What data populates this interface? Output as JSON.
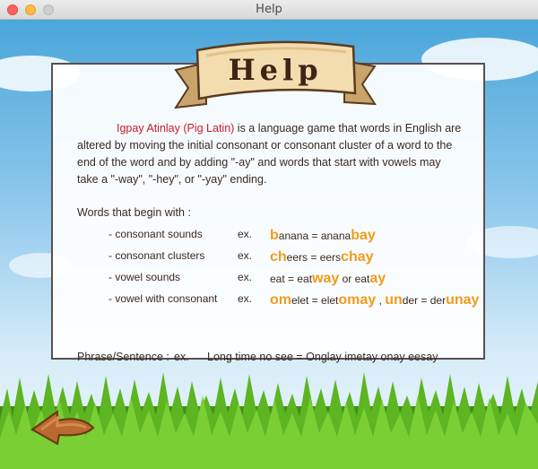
{
  "window": {
    "title": "Help"
  },
  "banner": {
    "title": "Help"
  },
  "intro": {
    "highlight": "Igpay Atinlay (Pig Latin)",
    "text": " is a language game that words in English are altered by moving the initial consonant or consonant cluster of a word to the end of the word and by adding \"-ay\" and words that start with vowels may take a \"-way\", \"-hey\", or \"-yay\" ending."
  },
  "words_heading": "Words that begin with :",
  "examples": [
    {
      "label": "- consonant sounds",
      "ex": "ex.",
      "parts": [
        [
          "b",
          "o"
        ],
        [
          "anana = anana",
          ""
        ],
        [
          "bay",
          "o"
        ]
      ]
    },
    {
      "label": "- consonant clusters",
      "ex": "ex.",
      "parts": [
        [
          "ch",
          "o"
        ],
        [
          "eers = eers",
          ""
        ],
        [
          "chay",
          "o"
        ]
      ]
    },
    {
      "label": "- vowel sounds",
      "ex": "ex.",
      "parts": [
        [
          "eat = eat",
          ""
        ],
        [
          "way",
          "o"
        ],
        [
          " or eat",
          ""
        ],
        [
          "ay",
          "o"
        ]
      ]
    },
    {
      "label": "- vowel with consonant",
      "ex": "ex.",
      "parts": [
        [
          "om",
          "o"
        ],
        [
          "elet = elet",
          ""
        ],
        [
          "omay",
          "o"
        ],
        [
          " , ",
          ""
        ],
        [
          "un",
          "o"
        ],
        [
          "der = der",
          ""
        ],
        [
          "unay",
          "o"
        ]
      ]
    }
  ],
  "phrase": {
    "label": "Phrase/Sentence :",
    "ex": "ex.",
    "text": "Long time no see = Onglay imetay onay eesay"
  },
  "colors": {
    "highlight": "#c8202a",
    "accent": "#f29a1c",
    "text": "#3a2820"
  }
}
